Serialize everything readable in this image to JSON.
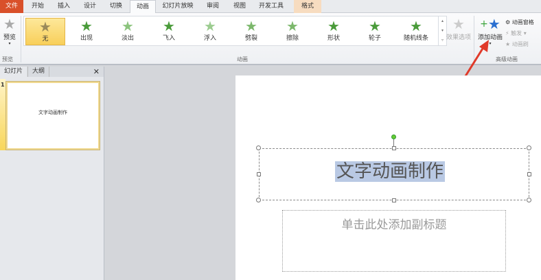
{
  "tabs": [
    "文件",
    "开始",
    "插入",
    "设计",
    "切换",
    "动画",
    "幻灯片放映",
    "审阅",
    "视图",
    "开发工具",
    "格式"
  ],
  "preview": {
    "label": "预览",
    "group": "预览"
  },
  "effects": [
    "无",
    "出现",
    "淡出",
    "飞入",
    "浮入",
    "劈裂",
    "擦除",
    "形状",
    "轮子",
    "随机线条"
  ],
  "effect_options": "效果选项",
  "animation_group": "动画",
  "add_animation": "添加动画",
  "advanced": {
    "pane": "动画窗格",
    "trigger": "触发",
    "painter": "动画刷",
    "group": "高级动画"
  },
  "panel": {
    "tab_slides": "幻灯片",
    "tab_outline": "大纲",
    "close": "✕",
    "slide_num": "1",
    "thumb_text": "文字动画制作"
  },
  "slide": {
    "title": "文字动画制作",
    "subtitle_placeholder": "单击此处添加副标题"
  },
  "colors": {
    "accent": "#d9502a",
    "selection": "#b9c9e4"
  }
}
